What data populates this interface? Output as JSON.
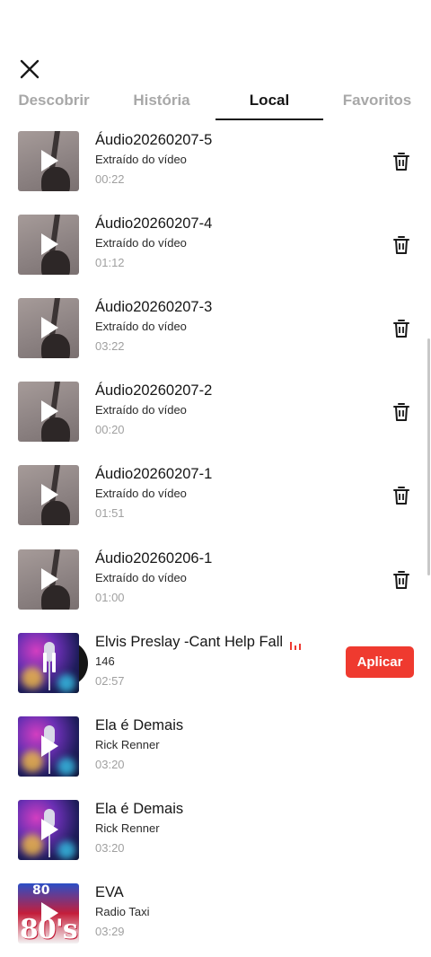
{
  "header": {
    "close_icon": "close-icon"
  },
  "tabs": [
    {
      "label": "Descobrir",
      "active": false
    },
    {
      "label": "História",
      "active": false
    },
    {
      "label": "Local",
      "active": true
    },
    {
      "label": "Favoritos",
      "active": false
    }
  ],
  "items": [
    {
      "title": "Áudio20260207-5",
      "subtitle": "Extraído do vídeo",
      "duration": "00:22",
      "action": "delete"
    },
    {
      "title": "Áudio20260207-4",
      "subtitle": "Extraído do vídeo",
      "duration": "01:12",
      "action": "delete"
    },
    {
      "title": "Áudio20260207-3",
      "subtitle": "Extraído do vídeo",
      "duration": "03:22",
      "action": "delete"
    },
    {
      "title": "Áudio20260207-2",
      "subtitle": "Extraído do vídeo",
      "duration": "00:20",
      "action": "delete"
    },
    {
      "title": "Áudio20260207-1",
      "subtitle": "Extraído do vídeo",
      "duration": "01:51",
      "action": "delete"
    },
    {
      "title": "Áudio20260206-1",
      "subtitle": "Extraído do vídeo",
      "duration": "01:00",
      "action": "delete"
    },
    {
      "title": "Elvis Preslay -Cant Help Fall",
      "subtitle": "146",
      "duration": "02:57",
      "action": "apply",
      "playing": true
    },
    {
      "title": "Ela é Demais",
      "subtitle": "Rick  Renner",
      "duration": "03:20",
      "action": "none"
    },
    {
      "title": "Ela é Demais",
      "subtitle": "Rick  Renner",
      "duration": "03:20",
      "action": "none"
    },
    {
      "title": "EVA",
      "subtitle": "Radio Taxi",
      "duration": "03:29",
      "action": "none"
    }
  ],
  "apply_label": "Aplicar",
  "thumb_80s": {
    "top_text": "80",
    "big_text": "80's"
  },
  "colors": {
    "accent": "#ef3a2f",
    "active_tab": "#161616",
    "inactive_tab": "#a8a8a8",
    "duration_text": "#a0a0a0"
  }
}
